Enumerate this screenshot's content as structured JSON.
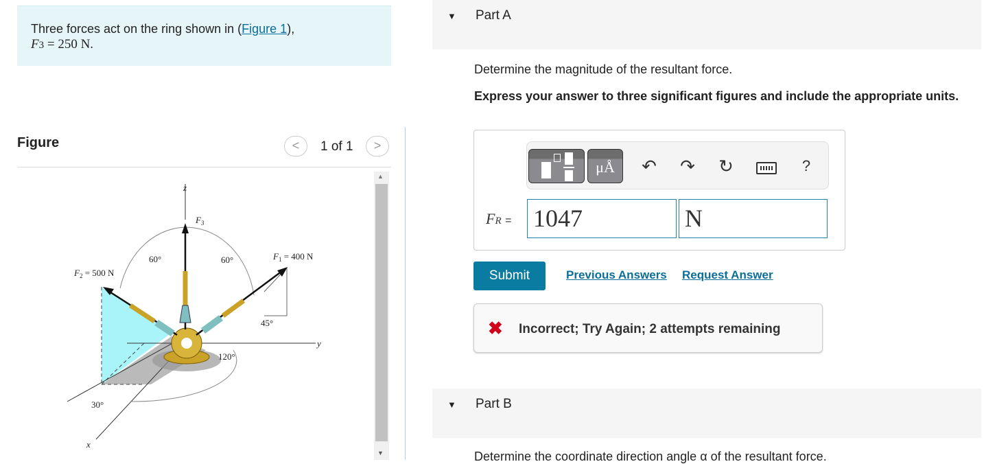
{
  "problem": {
    "text_before": "Three forces act on the ring shown in (",
    "figure_link": "Figure 1",
    "text_after": "),",
    "given_var": "F",
    "given_sub": "3",
    "given_value": " = 250 N."
  },
  "figure": {
    "title": "Figure",
    "pager": "1 of 1",
    "prev_icon": "chevron-left",
    "next_icon": "chevron-right",
    "labels": {
      "z": "z",
      "y": "y",
      "x": "x",
      "f3": "F",
      "f3_sub": "3",
      "f1": "F",
      "f1_sub": "1",
      "f1_value": " = 400 N",
      "f2": "F",
      "f2_sub": "2",
      "f2_value": " = 500 N",
      "a60l": "60°",
      "a60r": "60°",
      "a45": "45°",
      "a120": "120°",
      "a30": "30°"
    }
  },
  "partA": {
    "label": "Part A",
    "question": "Determine the magnitude of the resultant force.",
    "instruction": "Express your answer to three significant figures and include the appropriate units.",
    "toolbar": {
      "units_label": "μÅ",
      "help": "?"
    },
    "answer_var": "F",
    "answer_sub": "R",
    "equals": "=",
    "value": "1047",
    "units": "N",
    "submit": "Submit",
    "previous_answers": "Previous Answers",
    "request_answer": "Request Answer",
    "feedback": "Incorrect; Try Again; 2 attempts remaining",
    "feedback_color": "#d0021b"
  },
  "partB": {
    "label": "Part B",
    "question": "Determine the coordinate direction angle α of the resultant force."
  },
  "colors": {
    "accent": "#0a7ba1",
    "problem_bg": "#e6f5f7"
  }
}
